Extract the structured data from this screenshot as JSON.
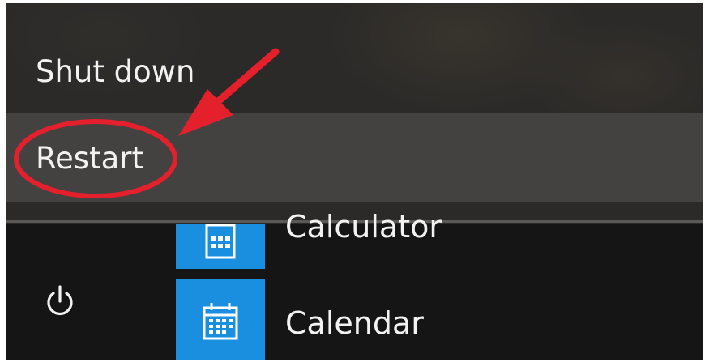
{
  "power_menu": {
    "items": [
      {
        "label": "Shut down"
      },
      {
        "label": "Restart"
      }
    ]
  },
  "start_menu": {
    "power_icon": "power-icon",
    "apps": [
      {
        "label": "Calculator",
        "icon": "calculator-icon"
      },
      {
        "label": "Calendar",
        "icon": "calendar-icon"
      }
    ]
  },
  "colors": {
    "tile_accent": "#1a8fe0",
    "annotation_red": "#e3202c",
    "highlight": "#434241"
  }
}
